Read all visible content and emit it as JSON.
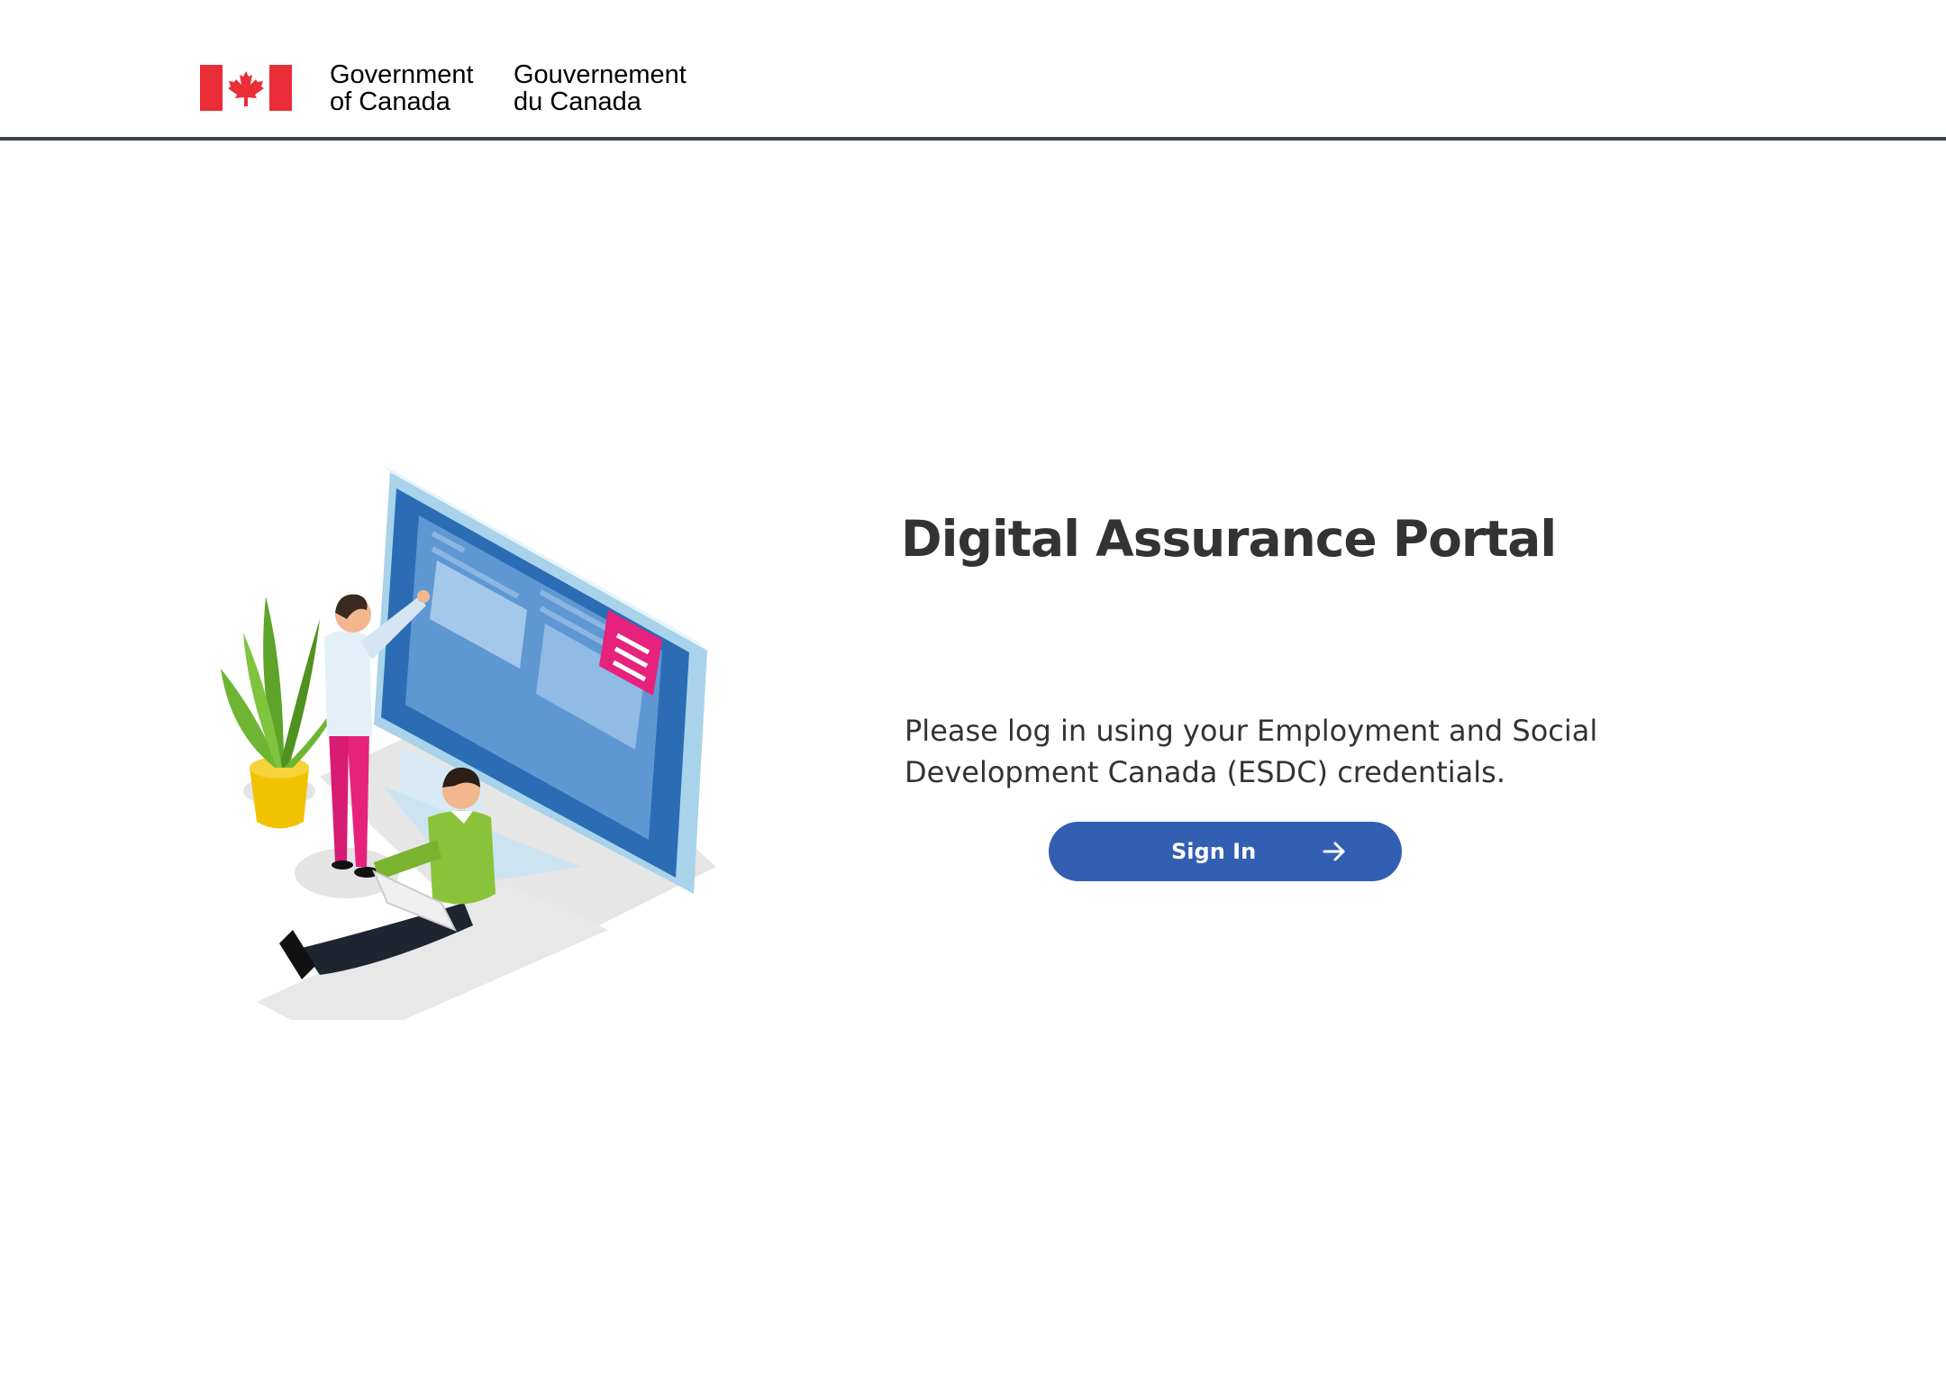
{
  "header": {
    "wordmark_en_line1": "Government",
    "wordmark_en_line2": "of Canada",
    "wordmark_fr_line1": "Gouvernement",
    "wordmark_fr_line2": "du Canada",
    "flag_icon": "canada-flag-icon",
    "colors": {
      "flag_red": "#eb2d37",
      "rule": "#3b4550"
    }
  },
  "main": {
    "title": "Digital Assurance Portal",
    "intro": "Please log in using your Employment and Social Development Canada (ESDC) credentials.",
    "signin_label": "Sign In",
    "signin_icon": "arrow-right-icon",
    "colors": {
      "button": "#335fb3",
      "text": "#333333"
    }
  }
}
